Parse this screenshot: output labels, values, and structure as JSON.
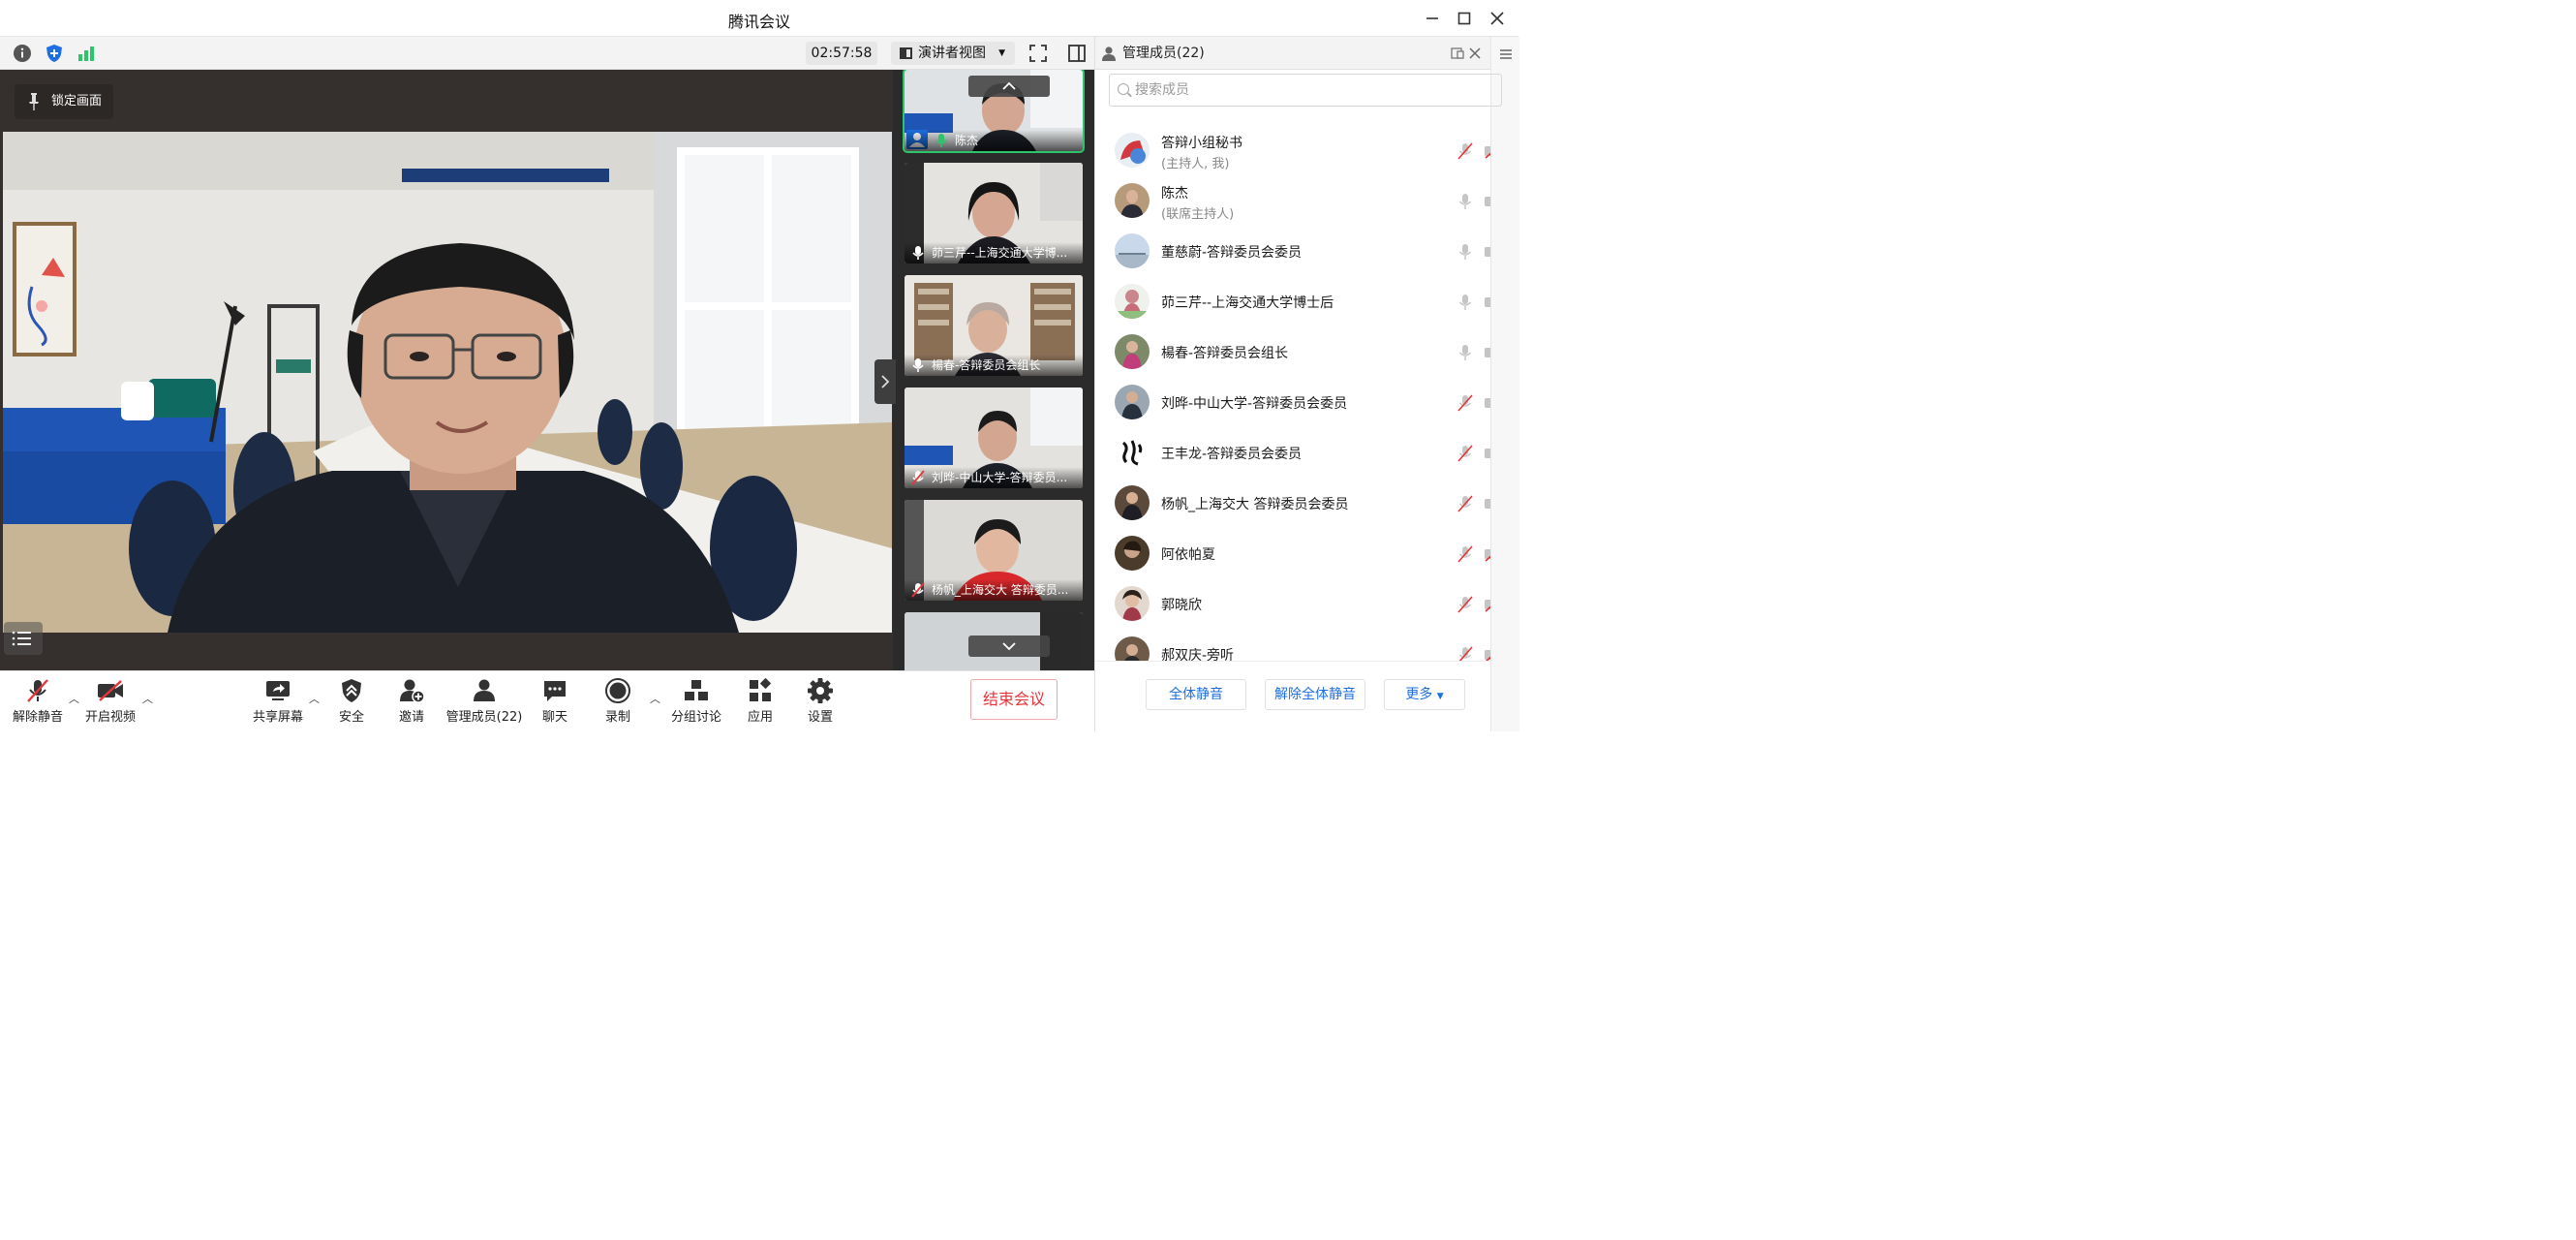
{
  "window": {
    "title": "腾讯会议"
  },
  "topbar": {
    "timer": "02:57:58",
    "view_mode": "演讲者视图"
  },
  "stage": {
    "pin_label": "锁定画面"
  },
  "thumbnails": [
    {
      "name": "陈杰",
      "mic": "on",
      "active": true
    },
    {
      "name": "茆三芹--上海交通大学博...",
      "mic": "on"
    },
    {
      "name": "楊春-答辩委员会组长",
      "mic": "on"
    },
    {
      "name": "刘晔-中山大学-答辩委员...",
      "mic": "muted"
    },
    {
      "name": "杨帆_上海交大 答辩委员...",
      "mic": "muted"
    },
    {
      "name": "",
      "mic": "none"
    }
  ],
  "toolbar": {
    "unmute": "解除静音",
    "start_video": "开启视频",
    "share_screen": "共享屏幕",
    "security": "安全",
    "invite": "邀请",
    "manage_members": "管理成员(22)",
    "chat": "聊天",
    "record": "录制",
    "breakout": "分组讨论",
    "apps": "应用",
    "settings": "设置",
    "end_meeting": "结束会议"
  },
  "panel": {
    "title": "管理成员(22)",
    "search_placeholder": "搜索成员",
    "members": [
      {
        "name": "答辩小组秘书",
        "role": "(主持人, 我)",
        "mic": "muted",
        "cam": "off"
      },
      {
        "name": "陈杰",
        "role": "(联席主持人)",
        "mic": "on",
        "cam": "on"
      },
      {
        "name": "董慈蔚-答辩委员会委员",
        "role": "",
        "mic": "on",
        "cam": "on"
      },
      {
        "name": "茆三芹--上海交通大学博士后",
        "role": "",
        "mic": "on",
        "cam": "on"
      },
      {
        "name": "楊春-答辩委员会组长",
        "role": "",
        "mic": "on",
        "cam": "on"
      },
      {
        "name": "刘晔-中山大学-答辩委员会委员",
        "role": "",
        "mic": "muted",
        "cam": "on"
      },
      {
        "name": "王丰龙-答辩委员会委员",
        "role": "",
        "mic": "muted",
        "cam": "on"
      },
      {
        "name": "杨帆_上海交大 答辩委员会委员",
        "role": "",
        "mic": "muted",
        "cam": "on"
      },
      {
        "name": "阿依帕夏",
        "role": "",
        "mic": "muted",
        "cam": "off"
      },
      {
        "name": "郭晓欣",
        "role": "",
        "mic": "muted",
        "cam": "off"
      },
      {
        "name": "郝双庆-旁听",
        "role": "",
        "mic": "muted",
        "cam": "off"
      }
    ],
    "mute_all": "全体静音",
    "unmute_all": "解除全体静音",
    "more": "更多"
  },
  "colors": {
    "accent": "#1d6fe0",
    "danger": "#e5343a",
    "active_speaker": "#2ec46a"
  }
}
